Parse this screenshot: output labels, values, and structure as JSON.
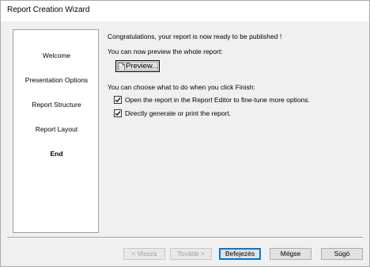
{
  "window": {
    "title": "Report Creation Wizard"
  },
  "nav": {
    "items": [
      {
        "label": "Welcome"
      },
      {
        "label": "Presentation Options"
      },
      {
        "label": "Report Structure"
      },
      {
        "label": "Report Layout"
      },
      {
        "label": "End",
        "active": true
      }
    ]
  },
  "content": {
    "congrats_text": "Congratulations, your report is now ready to be published !",
    "preview_text": "You can now preview the whole report:",
    "preview_button_label": "Preview...",
    "finish_text": "You can choose what to do when you click Finish:",
    "options": [
      {
        "label": "Open the report in the Report Editor to fine-tune more options.",
        "checked": true
      },
      {
        "label": "Directly generate or print the report.",
        "checked": true
      }
    ]
  },
  "footer": {
    "back_label": "< Vissza",
    "next_label": "Tovább >",
    "finish_label": "Befejezés",
    "cancel_label": "Mégse",
    "help_label": "Súgó"
  }
}
